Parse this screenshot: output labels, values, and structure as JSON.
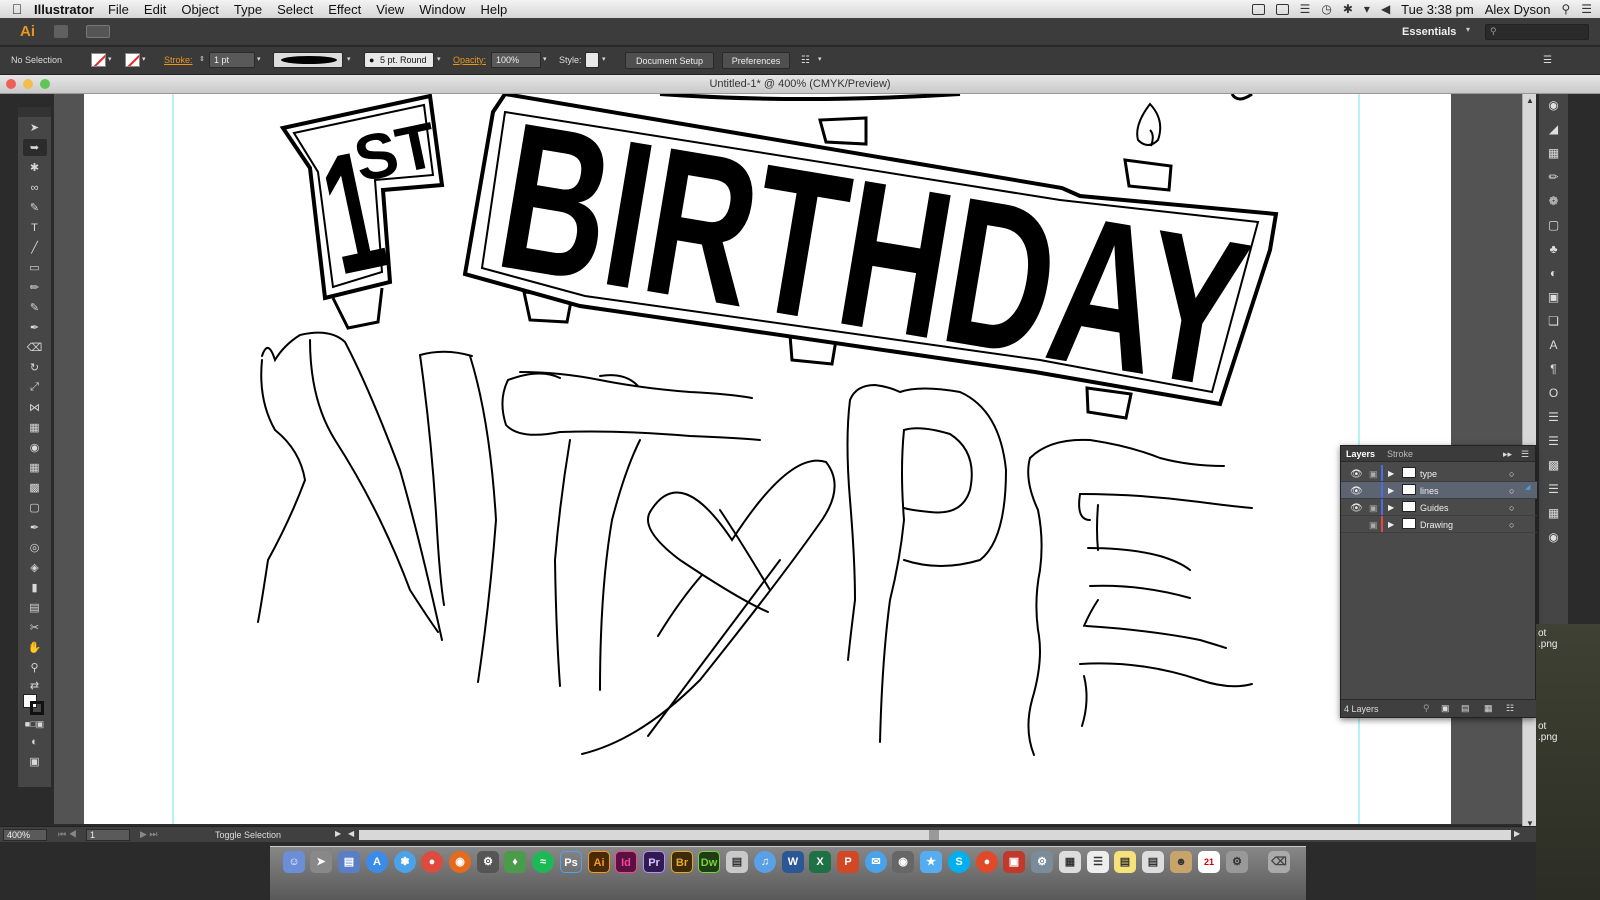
{
  "menubar": {
    "app_name": "Illustrator",
    "menus": [
      "File",
      "Edit",
      "Object",
      "Type",
      "Select",
      "Effect",
      "View",
      "Window",
      "Help"
    ],
    "clock": "Tue 3:38 pm",
    "user": "Alex Dyson"
  },
  "appbar": {
    "logo": "Ai",
    "workspace": "Essentials"
  },
  "controlbar": {
    "selection_status": "No Selection",
    "stroke_label": "Stroke:",
    "stroke_weight": "1 pt",
    "brush_label": "5 pt. Round",
    "opacity_label": "Opacity:",
    "opacity_value": "100%",
    "style_label": "Style:",
    "document_setup": "Document Setup",
    "preferences": "Preferences"
  },
  "document": {
    "title": "Untitled-1* @ 400% (CMYK/Preview)"
  },
  "artwork": {
    "ordinal_number": "1",
    "ordinal_suffix": "ST",
    "banner_text": "BIRTHDAY"
  },
  "statusbar": {
    "zoom": "400%",
    "artboard_number": "1",
    "status_text": "Toggle Selection"
  },
  "layers_panel": {
    "tabs": [
      "Layers",
      "Stroke"
    ],
    "layers": [
      {
        "name": "type",
        "visible": true,
        "selected": false,
        "color": "#4a6ee0"
      },
      {
        "name": "lines",
        "visible": true,
        "selected": true,
        "color": "#4a6ee0"
      },
      {
        "name": "Guides",
        "visible": true,
        "selected": false,
        "color": "#4a6ee0"
      },
      {
        "name": "Drawing",
        "visible": false,
        "selected": false,
        "color": "#e04a4a"
      }
    ],
    "count": "4 Layers"
  },
  "desktop_files": [
    "ot\n.png",
    "ot\n.png"
  ],
  "dock": [
    {
      "label": "Ps",
      "color": "#1b3a6b"
    },
    {
      "label": "Ai",
      "color": "#4a2a06"
    },
    {
      "label": "Id",
      "color": "#5b1140"
    },
    {
      "label": "Pr",
      "color": "#2f1b52"
    },
    {
      "label": "Br",
      "color": "#3c2a08"
    },
    {
      "label": "Dw",
      "color": "#1f3d12"
    },
    {
      "label": "W",
      "color": "#2b5797"
    },
    {
      "label": "X",
      "color": "#1e7145"
    },
    {
      "label": "P",
      "color": "#d24726"
    }
  ],
  "colors": {
    "accent": "#e8961e",
    "panel": "#4a4a4a",
    "selected_layer": "#5d6471"
  }
}
